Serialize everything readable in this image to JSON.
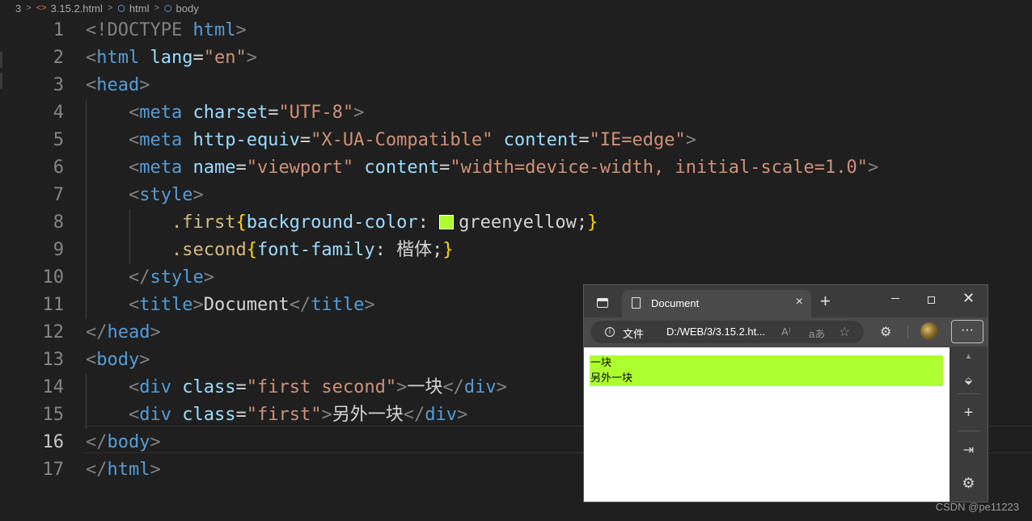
{
  "breadcrumb": {
    "folder": "3",
    "file": "3.15.2.html",
    "node1": "html",
    "node2": "body"
  },
  "editor": {
    "active_line": 16,
    "lines": [
      {
        "num": "1"
      },
      {
        "num": "2"
      },
      {
        "num": "3"
      },
      {
        "num": "4"
      },
      {
        "num": "5"
      },
      {
        "num": "6"
      },
      {
        "num": "7"
      },
      {
        "num": "8"
      },
      {
        "num": "9"
      },
      {
        "num": "10"
      },
      {
        "num": "11"
      },
      {
        "num": "12"
      },
      {
        "num": "13"
      },
      {
        "num": "14"
      },
      {
        "num": "15"
      },
      {
        "num": "16"
      },
      {
        "num": "17"
      }
    ],
    "code": {
      "l1": {
        "open": "<!DOCTYPE ",
        "tag": "html",
        "close": ">"
      },
      "l2": {
        "open": "<",
        "tag": "html",
        "attr": "lang",
        "eq": "=",
        "val": "\"en\"",
        "close": ">"
      },
      "l3": {
        "open": "<",
        "tag": "head",
        "close": ">"
      },
      "l4": {
        "open": "<",
        "tag": "meta",
        "attr": "charset",
        "eq": "=",
        "val": "\"UTF-8\"",
        "close": ">"
      },
      "l5": {
        "open": "<",
        "tag": "meta",
        "attr1": "http-equiv",
        "eq1": "=",
        "val1": "\"X-UA-Compatible\"",
        "attr2": "content",
        "eq2": "=",
        "val2": "\"IE=edge\"",
        "close": ">"
      },
      "l6": {
        "open": "<",
        "tag": "meta",
        "attr1": "name",
        "eq1": "=",
        "val1": "\"viewport\"",
        "attr2": "content",
        "eq2": "=",
        "val2": "\"width=device-width, initial-scale=1.0\"",
        "close": ">"
      },
      "l7": {
        "open": "<",
        "tag": "style",
        "close": ">"
      },
      "l8": {
        "sel": ".first",
        "lb": "{",
        "prop": "background-color",
        "colon": ": ",
        "value": "greenyellow",
        "semi": ";",
        "rb": "}",
        "swatch_color": "#adff2f"
      },
      "l9": {
        "sel": ".second",
        "lb": "{",
        "prop": "font-family",
        "colon": ": ",
        "value": "楷体",
        "semi": ";",
        "rb": "}"
      },
      "l10": {
        "open": "</",
        "tag": "style",
        "close": ">"
      },
      "l11": {
        "open": "<",
        "tag": "title",
        "close": ">",
        "text": "Document",
        "open2": "</",
        "tag2": "title",
        "close2": ">"
      },
      "l12": {
        "open": "</",
        "tag": "head",
        "close": ">"
      },
      "l13": {
        "open": "<",
        "tag": "body",
        "close": ">"
      },
      "l14": {
        "open": "<",
        "tag": "div",
        "attr": "class",
        "eq": "=",
        "val": "\"first second\"",
        "close": ">",
        "text": "一块",
        "open2": "</",
        "tag2": "div",
        "close2": ">"
      },
      "l15": {
        "open": "<",
        "tag": "div",
        "attr": "class",
        "eq": "=",
        "val": "\"first\"",
        "close": ">",
        "text": "另外一块",
        "open2": "</",
        "tag2": "div",
        "close2": ">"
      },
      "l16": {
        "open": "</",
        "tag": "body",
        "close": ">"
      },
      "l17": {
        "open": "</",
        "tag": "html",
        "close": ">"
      }
    }
  },
  "browser": {
    "tab_title": "Document",
    "tab_close": "×",
    "new_tab": "+",
    "minimize": "",
    "close": "✕",
    "site_label": "文件",
    "url": "D:/WEB/3/3.15.2.ht...",
    "read_aloud": "A⁾",
    "translate": "aあ",
    "favorite": "☆",
    "extensions": "⚙",
    "more": "···",
    "content": {
      "div_first_second": "一块",
      "div_first": "另外一块"
    },
    "div_color": "#adff2f",
    "sidebar": {
      "search": "",
      "add": "+",
      "collapse": "⇥",
      "settings": "⚙"
    }
  },
  "watermark": "CSDN @pe11223"
}
